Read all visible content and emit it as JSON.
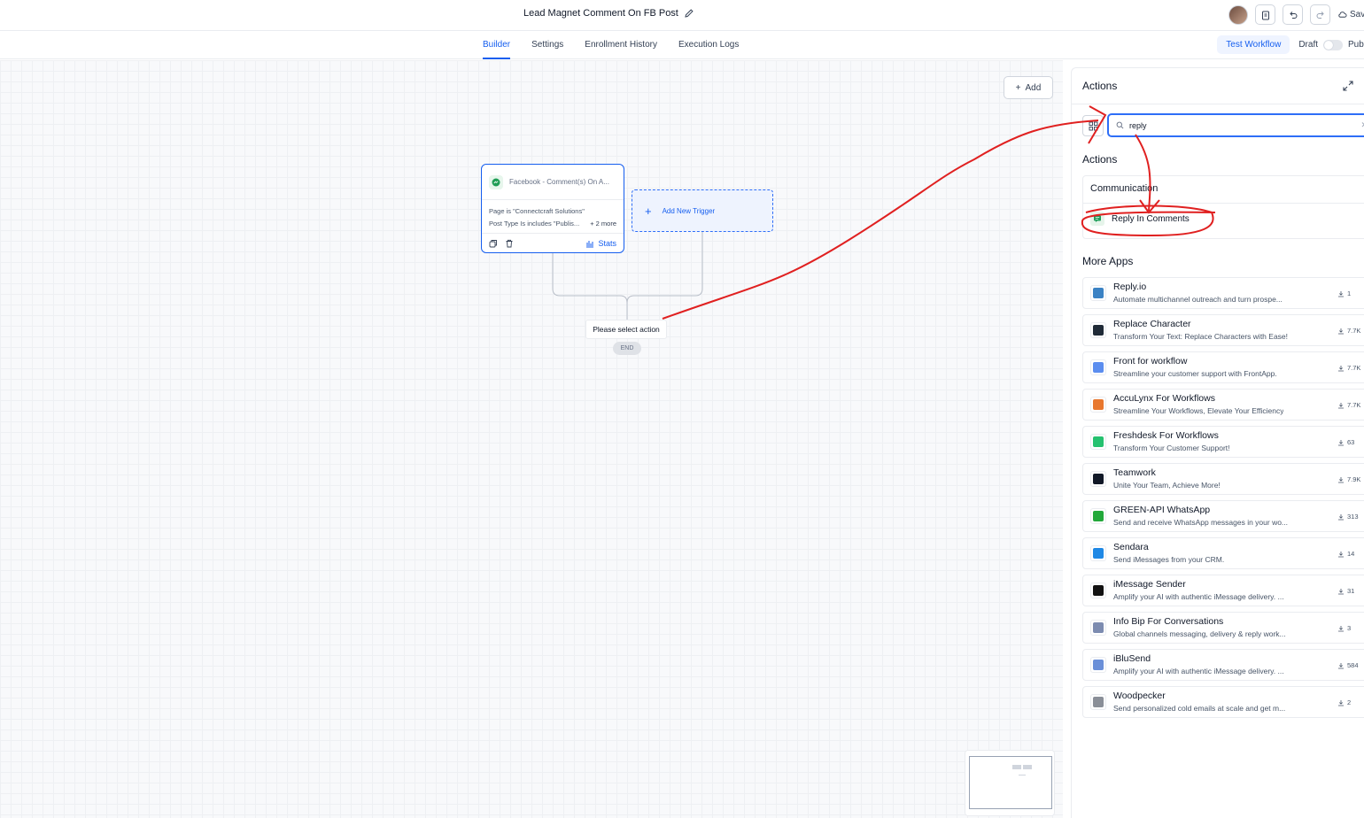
{
  "header": {
    "workflow_title": "Lead Magnet Comment On FB Post",
    "save_label": "Save"
  },
  "tabs": [
    {
      "label": "Builder",
      "active": true
    },
    {
      "label": "Settings"
    },
    {
      "label": "Enrollment History"
    },
    {
      "label": "Execution Logs"
    }
  ],
  "toolbar": {
    "test_label": "Test Workflow",
    "draft_label": "Draft",
    "publish_label": "Publish",
    "published": false
  },
  "canvas": {
    "add_label": "Add",
    "trigger": {
      "title": "Facebook - Comment(s) On A...",
      "line1": "Page is \"Connectcraft Solutions\"",
      "line2": "Post Type Is includes \"Publis...",
      "more": "+ 2 more",
      "stats_label": "Stats"
    },
    "new_trigger_label": "Add New Trigger",
    "select_action_label": "Please select action",
    "end_label": "END"
  },
  "panel": {
    "title": "Actions",
    "search_value": "reply",
    "actions_heading": "Actions",
    "category": "Communication",
    "action_item": "Reply In Comments",
    "more_apps_heading": "More Apps",
    "apps": [
      {
        "name": "Reply.io",
        "desc": "Automate multichannel outreach and turn prospe...",
        "downloads": "1",
        "color": "#3b82c4"
      },
      {
        "name": "Replace Character",
        "desc": "Transform Your Text: Replace Characters with Ease!",
        "downloads": "7.7K",
        "color": "#1f2a37"
      },
      {
        "name": "Front for workflow",
        "desc": "Streamline your customer support with FrontApp.",
        "downloads": "7.7K",
        "color": "#5b8def"
      },
      {
        "name": "AccuLynx For Workflows",
        "desc": "Streamline Your Workflows, Elevate Your Efficiency",
        "downloads": "7.7K",
        "color": "#e8772e"
      },
      {
        "name": "Freshdesk For Workflows",
        "desc": "Transform Your Customer Support!",
        "downloads": "63",
        "color": "#25c16f"
      },
      {
        "name": "Teamwork",
        "desc": "Unite Your Team, Achieve More!",
        "downloads": "7.9K",
        "color": "#111827"
      },
      {
        "name": "GREEN-API WhatsApp",
        "desc": "Send and receive WhatsApp messages in your wo...",
        "downloads": "313",
        "color": "#22a83a"
      },
      {
        "name": "Sendara",
        "desc": "Send iMessages from your CRM.",
        "downloads": "14",
        "color": "#1e88e5"
      },
      {
        "name": "iMessage Sender",
        "desc": "Amplify your AI with authentic iMessage delivery. ...",
        "downloads": "31",
        "color": "#111111"
      },
      {
        "name": "Info Bip For Conversations",
        "desc": "Global channels messaging, delivery & reply work...",
        "downloads": "3",
        "color": "#7c8bb0"
      },
      {
        "name": "iBluSend",
        "desc": "Amplify your AI with authentic iMessage delivery. ...",
        "downloads": "584",
        "color": "#6a8fd8"
      },
      {
        "name": "Woodpecker",
        "desc": "Send personalized cold emails at scale and get m...",
        "downloads": "2",
        "color": "#8a8f98"
      }
    ]
  }
}
